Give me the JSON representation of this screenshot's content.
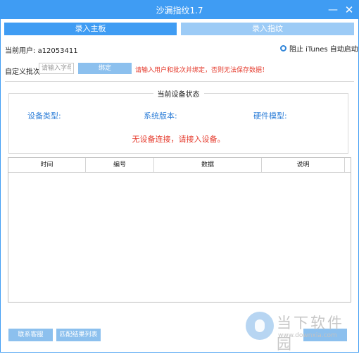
{
  "window": {
    "title": "沙漏指纹1.7",
    "min_glyph": "—",
    "close_glyph": "✕"
  },
  "tabs": [
    {
      "label": "录入主板",
      "active": true
    },
    {
      "label": "录入指纹",
      "active": false
    }
  ],
  "user": {
    "label": "当前用户:",
    "value": "a12053411"
  },
  "itunes_option": {
    "label": "阻止 iTunes 自动启动",
    "checked": true
  },
  "batch": {
    "label": "自定义批次:",
    "placeholder": "请输入字母",
    "value": "",
    "bind_button": "绑定",
    "warning": "请输入用户和批次并绑定，否则无法保存数据！"
  },
  "device_status": {
    "title": "当前设备状态",
    "type_label": "设备类型:",
    "system_label": "系统版本:",
    "hardware_label": "硬件模型:",
    "message": "无设备连接，请接入设备。"
  },
  "table": {
    "columns": [
      "时间",
      "编号",
      "数据",
      "说明"
    ],
    "rows": []
  },
  "footer": {
    "contact_button": "联系客服",
    "list_button": "匹配结果列表",
    "right_button": ""
  },
  "watermark": {
    "text": "当下软件园",
    "sub": "www.downxia.com"
  },
  "colors": {
    "accent": "#3f9cf3",
    "accent_light": "#9ccbf6",
    "button_light": "#8cc0ee",
    "warning": "#e53a2c",
    "label_blue": "#2f7fd8"
  }
}
